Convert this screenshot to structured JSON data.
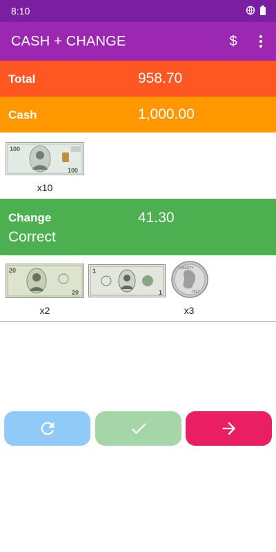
{
  "status_bar": {
    "time": "8:10"
  },
  "app_bar": {
    "title": "CASH + CHANGE"
  },
  "total": {
    "label": "Total",
    "value": "958.70"
  },
  "cash": {
    "label": "Cash",
    "value": "1,000.00",
    "items": [
      {
        "note": "$100 bill",
        "count": "x10"
      }
    ]
  },
  "change": {
    "label": "Change",
    "value": "41.30",
    "status": "Correct",
    "items": [
      {
        "note": "$20 bill",
        "count": "x2"
      },
      {
        "note": "$1 bill",
        "count": ""
      },
      {
        "note": "dime",
        "count": "x3"
      }
    ]
  },
  "buttons": {
    "reset": "refresh-icon",
    "confirm": "check-icon",
    "next": "arrow-right-icon"
  },
  "colors": {
    "status_bar": "#7b1fa2",
    "app_bar": "#9c27b0",
    "total": "#ff5722",
    "cash": "#ff9800",
    "change": "#4caf50",
    "reset_button": "#90caf9",
    "confirm_button": "#a5d6a7",
    "next_button": "#e91e63"
  }
}
